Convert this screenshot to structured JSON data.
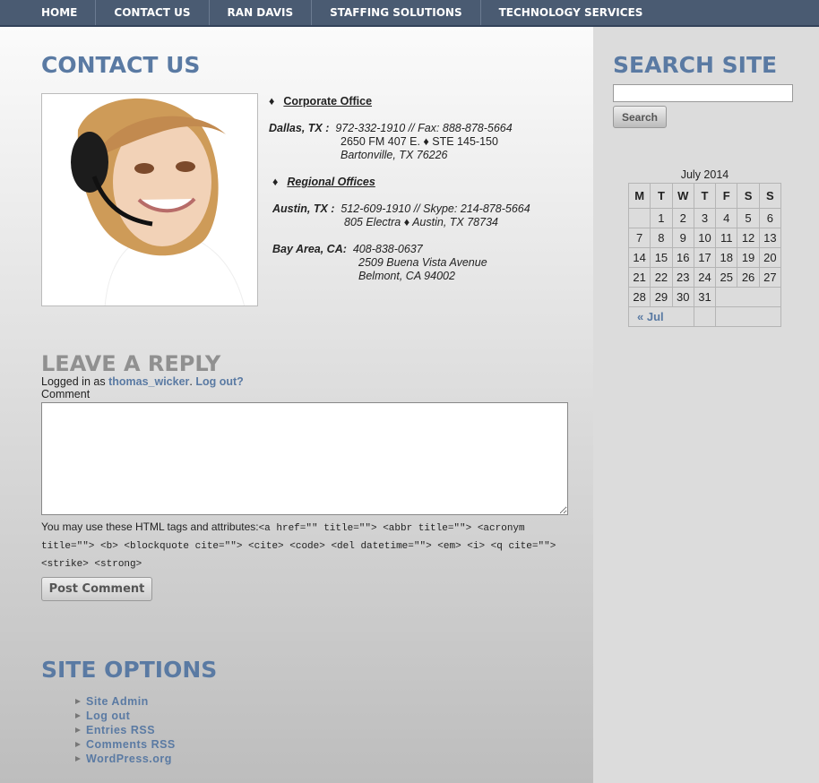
{
  "nav": [
    "HOME",
    "CONTACT US",
    "RAN DAVIS",
    "STAFFING SOLUTIONS",
    "TECHNOLOGY SERVICES"
  ],
  "page": {
    "title": "CONTACT US",
    "corporate_heading": "Corporate Office",
    "dallas": {
      "city": "Dallas, TX :",
      "phones": "972-332-1910  //  Fax:  888-878-5664",
      "addr1": "2650 FM 407 E. ♦  STE 145-150",
      "addr2": "Bartonville, TX 76226"
    },
    "regional_heading": "Regional Offices",
    "austin": {
      "city": "Austin, TX :",
      "phones": "512-609-1910  // Skype: 214-878-5664",
      "addr": "805 Electra  ♦  Austin, TX 78734"
    },
    "bay": {
      "city": "Bay Area, CA:",
      "phone": "408-838-0637",
      "addr1": "2509 Buena Vista Avenue",
      "addr2": "Belmont, CA 94002"
    }
  },
  "reply": {
    "title": "LEAVE A REPLY",
    "logged_prefix": "Logged in as",
    "user": "thomas_wicker",
    "logout": "Log out?",
    "comment_label": "Comment",
    "allowed_prefix": "You may use these HTML tags and attributes:",
    "allowed_tags": "<a href=\"\" title=\"\"> <abbr title=\"\"> <acronym title=\"\"> <b> <blockquote cite=\"\"> <cite> <code> <del datetime=\"\"> <em> <i> <q cite=\"\"> <strike> <strong>",
    "post_label": "Post Comment"
  },
  "options": {
    "title": "SITE OPTIONS",
    "links": [
      "Site Admin",
      "Log out",
      "Entries RSS",
      "Comments RSS",
      "WordPress.org"
    ]
  },
  "sidebar": {
    "search_title": "SEARCH SITE",
    "search_button": "Search",
    "calendar": {
      "caption": "July 2014",
      "days": [
        "M",
        "T",
        "W",
        "T",
        "F",
        "S",
        "S"
      ],
      "weeks": [
        [
          "",
          "1",
          "2",
          "3",
          "4",
          "5",
          "6"
        ],
        [
          "7",
          "8",
          "9",
          "10",
          "11",
          "12",
          "13"
        ],
        [
          "14",
          "15",
          "16",
          "17",
          "18",
          "19",
          "20"
        ],
        [
          "21",
          "22",
          "23",
          "24",
          "25",
          "26",
          "27"
        ],
        [
          "28",
          "29",
          "30",
          "31",
          "",
          "",
          ""
        ]
      ],
      "prev": "« Jul"
    }
  }
}
